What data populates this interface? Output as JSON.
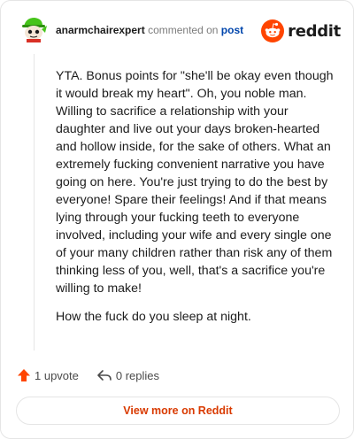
{
  "header": {
    "username": "anarmchairexpert",
    "action_text": "commented on",
    "post_link": "post",
    "logo_text": "reddit",
    "avatar_icon": "snoo-avatar-icon",
    "logo_icon": "reddit-snoo-icon"
  },
  "comment": {
    "paragraphs": [
      "YTA. Bonus points for \"she'll be okay even though it would break my heart\". Oh, you noble man. Willing to sacrifice a relationship with your daughter and live out your days broken-hearted and hollow inside, for the sake of others. What an extremely fucking convenient narrative you have going on here. You're just trying to do the best by everyone! Spare their feelings! And if that means lying through your fucking teeth to everyone involved, including your wife and every single one of your many children rather than risk any of them thinking less of you, well, that's a sacrifice you're willing to make!",
      "How the fuck do you sleep at night."
    ]
  },
  "actions": {
    "upvote_label": "1 upvote",
    "replies_label": "0 replies",
    "upvote_icon": "upvote-arrow-icon",
    "reply_icon": "reply-arrow-icon"
  },
  "footer": {
    "view_more_label": "View more on Reddit"
  },
  "colors": {
    "brand": "#ff4500",
    "link": "#0045ac",
    "view_more_text": "#d93a00",
    "border": "#e5e5e5"
  }
}
